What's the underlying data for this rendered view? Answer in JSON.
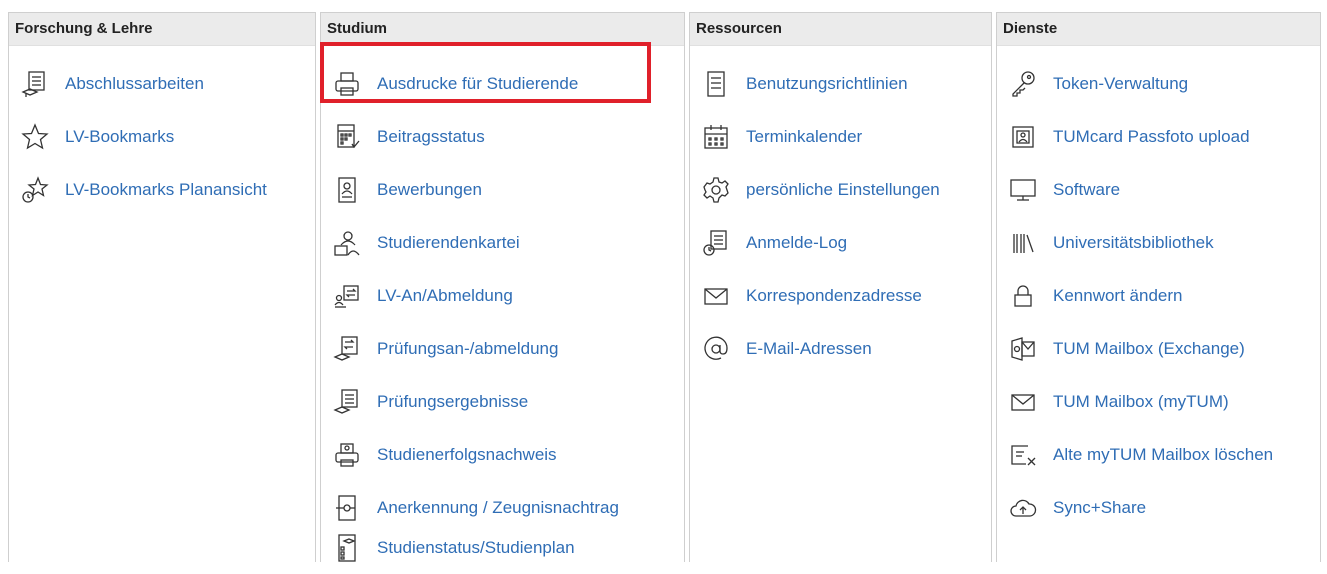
{
  "columns": [
    {
      "title": "Forschung & Lehre",
      "items": [
        {
          "label": "Abschlussarbeiten",
          "icon": "thesis-icon"
        },
        {
          "label": "LV-Bookmarks",
          "icon": "star-icon"
        },
        {
          "label": "LV-Bookmarks Planansicht",
          "icon": "star-clock-icon"
        }
      ]
    },
    {
      "title": "Studium",
      "items": [
        {
          "label": "Ausdrucke für Studierende",
          "icon": "printer-icon"
        },
        {
          "label": "Beitragsstatus",
          "icon": "calculator-icon"
        },
        {
          "label": "Bewerbungen",
          "icon": "application-icon"
        },
        {
          "label": "Studierendenkartei",
          "icon": "student-file-icon"
        },
        {
          "label": "LV-An/Abmeldung",
          "icon": "course-registration-icon"
        },
        {
          "label": "Prüfungsan-/abmeldung",
          "icon": "exam-registration-icon"
        },
        {
          "label": "Prüfungsergebnisse",
          "icon": "exam-results-icon"
        },
        {
          "label": "Studienerfolgsnachweis",
          "icon": "success-print-icon"
        },
        {
          "label": "Anerkennung / Zeugnisnachtrag",
          "icon": "recognition-icon"
        },
        {
          "label": "Studienstatus/Studienplan",
          "icon": "study-plan-icon"
        }
      ]
    },
    {
      "title": "Ressourcen",
      "items": [
        {
          "label": "Benutzungsrichtlinien",
          "icon": "document-icon"
        },
        {
          "label": "Terminkalender",
          "icon": "calendar-icon"
        },
        {
          "label": "persönliche Einstellungen",
          "icon": "gear-icon"
        },
        {
          "label": "Anmelde-Log",
          "icon": "log-icon"
        },
        {
          "label": "Korrespondenzadresse",
          "icon": "envelope-icon"
        },
        {
          "label": "E-Mail-Adressen",
          "icon": "at-icon"
        }
      ]
    },
    {
      "title": "Dienste",
      "items": [
        {
          "label": "Token-Verwaltung",
          "icon": "key-icon"
        },
        {
          "label": "TUMcard Passfoto upload",
          "icon": "photo-id-icon"
        },
        {
          "label": "Software",
          "icon": "monitor-icon"
        },
        {
          "label": "Universitätsbibliothek",
          "icon": "library-icon"
        },
        {
          "label": "Kennwort ändern",
          "icon": "lock-icon"
        },
        {
          "label": "TUM Mailbox (Exchange)",
          "icon": "exchange-icon"
        },
        {
          "label": "TUM Mailbox (myTUM)",
          "icon": "envelope-icon"
        },
        {
          "label": "Alte myTUM Mailbox löschen",
          "icon": "mailbox-delete-icon"
        },
        {
          "label": "Sync+Share",
          "icon": "cloud-upload-icon"
        }
      ]
    }
  ]
}
